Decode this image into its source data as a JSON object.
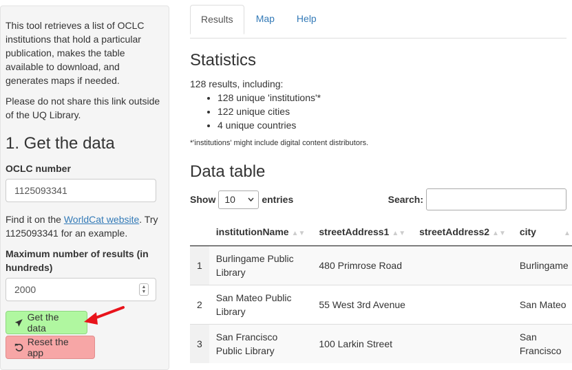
{
  "sidebar": {
    "intro": "This tool retrieves a list of OCLC institutions that hold a particular publication, makes the table available to download, and generates maps if needed.",
    "warning": "Please do not share this link outside of the UQ Library.",
    "heading": "1. Get the data",
    "oclc_label": "OCLC number",
    "oclc_value": "1125093341",
    "help_prefix": "Find it on the ",
    "help_link": "WorldCat website",
    "help_suffix": ". Try 1125093341 for an example.",
    "max_label": "Maximum number of results (in hundreds)",
    "max_value": "2000",
    "get_button": "Get the data",
    "reset_button": "Reset the app"
  },
  "tabs": [
    "Results",
    "Map",
    "Help"
  ],
  "stats": {
    "heading": "Statistics",
    "summary": "128 results, including:",
    "items": [
      "128 unique 'institutions'*",
      "122 unique cities",
      "4 unique countries"
    ],
    "footnote": "*'institutions' might include digital content distributors."
  },
  "table": {
    "heading": "Data table",
    "show_label": "Show",
    "page_size": "10",
    "entries_label": "entries",
    "search_label": "Search:",
    "columns": [
      "",
      "institutionName",
      "streetAddress1",
      "streetAddress2",
      "city"
    ],
    "rows": [
      [
        "1",
        "Burlingame Public Library",
        "480 Primrose Road",
        "",
        "Burlingame"
      ],
      [
        "2",
        "San Mateo Public Library",
        "55 West 3rd Avenue",
        "",
        "San Mateo"
      ],
      [
        "3",
        "San Francisco Public Library",
        "100 Larkin Street",
        "",
        "San Francisco"
      ]
    ]
  },
  "colors": {
    "get_button": "#b0f7a0",
    "reset_button": "#f7a6a6",
    "link": "#337ab7",
    "arrow": "#e8131b"
  }
}
